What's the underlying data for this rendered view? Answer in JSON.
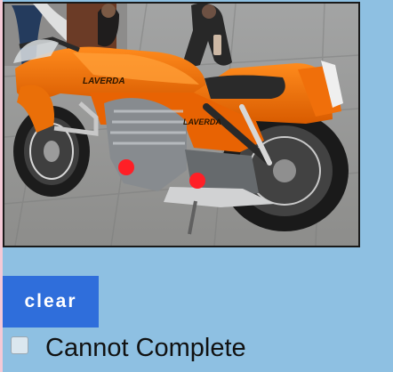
{
  "image": {
    "subject": "orange Laverda motorcycle",
    "tank_label": "LAVERDA",
    "side_label": "LAVERDA"
  },
  "markers": [
    {
      "color": "#ff1f26"
    },
    {
      "color": "#ff1f26"
    }
  ],
  "controls": {
    "clear_label": "clear",
    "clear_color": "#2f6edb",
    "checkbox_label": "Cannot Complete",
    "checkbox_checked": false
  }
}
